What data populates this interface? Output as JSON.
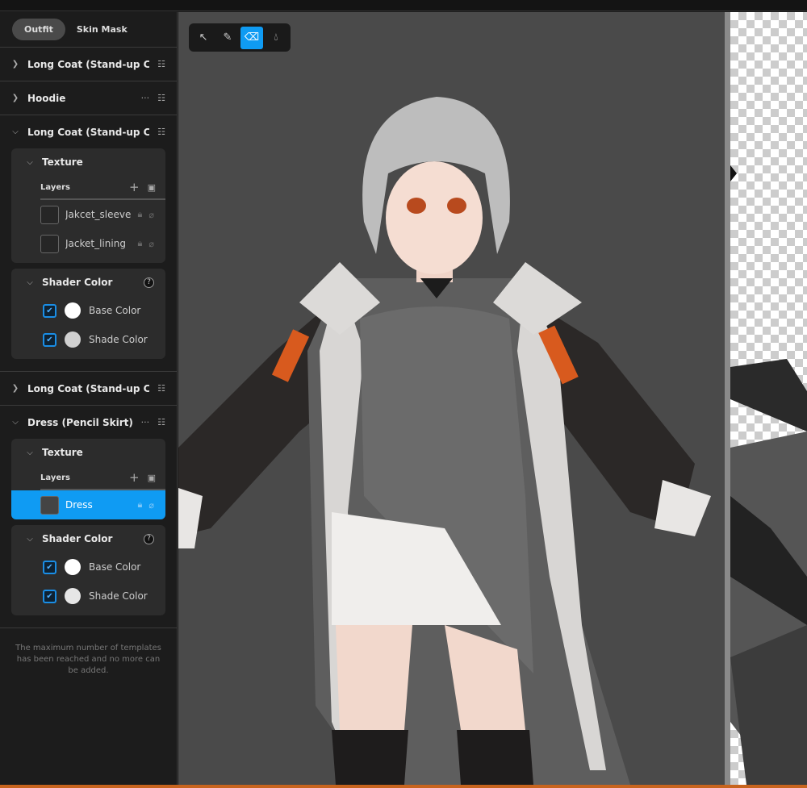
{
  "tabs": [
    {
      "label": "Outfit",
      "active": true
    },
    {
      "label": "Skin Mask",
      "active": false
    }
  ],
  "sections": [
    {
      "title": "Long Coat (Stand-up Col",
      "expanded": false,
      "more": false
    },
    {
      "title": "Hoodie",
      "expanded": false,
      "more": true
    },
    {
      "title": "Long Coat (Stand-up Col",
      "expanded": true,
      "more": false,
      "texture": {
        "title": "Texture",
        "layers_label": "Layers",
        "layers": [
          {
            "name": "Jakcet_sleeve"
          },
          {
            "name": "Jacket_lining"
          }
        ]
      },
      "shader": {
        "title": "Shader Color",
        "colors": [
          {
            "label": "Base Color",
            "color": "#ffffff"
          },
          {
            "label": "Shade Color",
            "color": "#d0d0d0"
          }
        ]
      }
    },
    {
      "title": "Long Coat (Stand-up Col",
      "expanded": false,
      "more": false
    },
    {
      "title": "Dress (Pencil Skirt)",
      "expanded": true,
      "more": true,
      "texture": {
        "title": "Texture",
        "layers_label": "Layers",
        "layers": [
          {
            "name": "Dress",
            "selected": true
          }
        ]
      },
      "shader": {
        "title": "Shader Color",
        "colors": [
          {
            "label": "Base Color",
            "color": "#ffffff"
          },
          {
            "label": "Shade Color",
            "color": "#e6e6e6"
          }
        ]
      }
    }
  ],
  "note": "The maximum number of templates has been reached and no more can be added.",
  "tools": [
    {
      "name": "select"
    },
    {
      "name": "pen"
    },
    {
      "name": "eraser",
      "active": true
    },
    {
      "name": "fill"
    }
  ],
  "colors": {
    "accent": "#0f9bf3",
    "bottom_bar": "#c8641e"
  }
}
